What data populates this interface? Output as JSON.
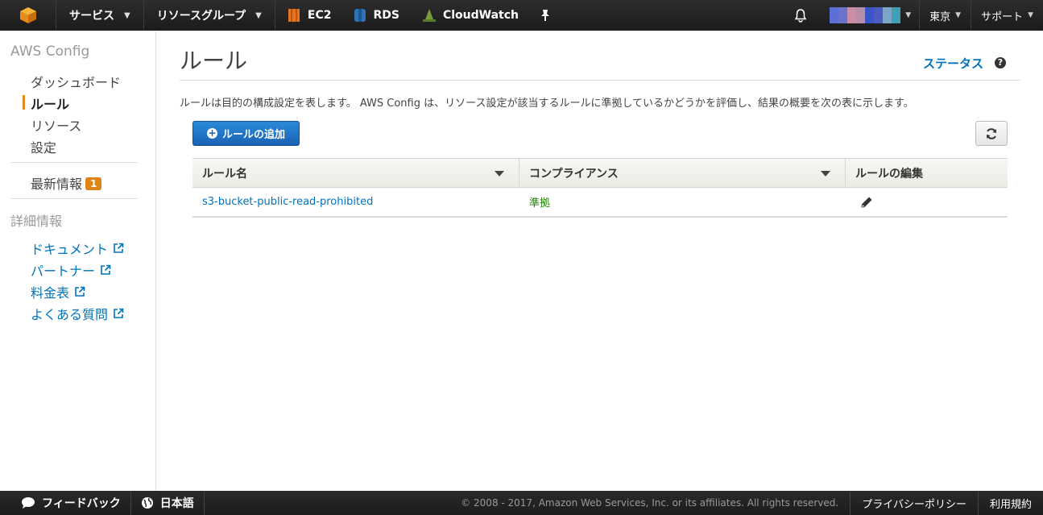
{
  "topnav": {
    "services_label": "サービス",
    "resource_groups_label": "リソースグループ",
    "shortcuts": [
      {
        "label": "EC2",
        "icon": "ec2-icon",
        "color": "#e7731c"
      },
      {
        "label": "RDS",
        "icon": "rds-icon",
        "color": "#2e73b8"
      },
      {
        "label": "CloudWatch",
        "icon": "cloudwatch-icon",
        "color": "#759c3e"
      }
    ],
    "region_label": "東京",
    "support_label": "サポート",
    "account_colors": [
      "#5b6fd6",
      "#6a73c9",
      "#c98ea6",
      "#b58fa8",
      "#3b55c9",
      "#4e5cbf",
      "#7ca5c7",
      "#3f9fb5"
    ]
  },
  "sidebar": {
    "title": "AWS Config",
    "items": [
      {
        "label": "ダッシュボード"
      },
      {
        "label": "ルール"
      },
      {
        "label": "リソース"
      },
      {
        "label": "設定"
      }
    ],
    "whats_new_label": "最新情報",
    "whats_new_count": "1",
    "details_title": "詳細情報",
    "links": [
      {
        "label": "ドキュメント"
      },
      {
        "label": "パートナー"
      },
      {
        "label": "料金表"
      },
      {
        "label": "よくある質問"
      }
    ]
  },
  "main": {
    "title": "ルール",
    "status_label": "ステータス",
    "help_glyph": "?",
    "description": "ルールは目的の構成設定を表します。 AWS Config は、リソース設定が該当するルールに準拠しているかどうかを評価し、結果の概要を次の表に示します。",
    "add_rule_label": "ルールの追加",
    "table": {
      "columns": [
        "ルール名",
        "コンプライアンス",
        "ルールの編集"
      ],
      "rows": [
        {
          "name": "s3-bucket-public-read-prohibited",
          "compliance": "準拠"
        }
      ]
    }
  },
  "footer": {
    "feedback_label": "フィードバック",
    "language_label": "日本語",
    "copyright": "© 2008 - 2017, Amazon Web Services, Inc. or its affiliates. All rights reserved.",
    "privacy_label": "プライバシーポリシー",
    "terms_label": "利用規約"
  }
}
